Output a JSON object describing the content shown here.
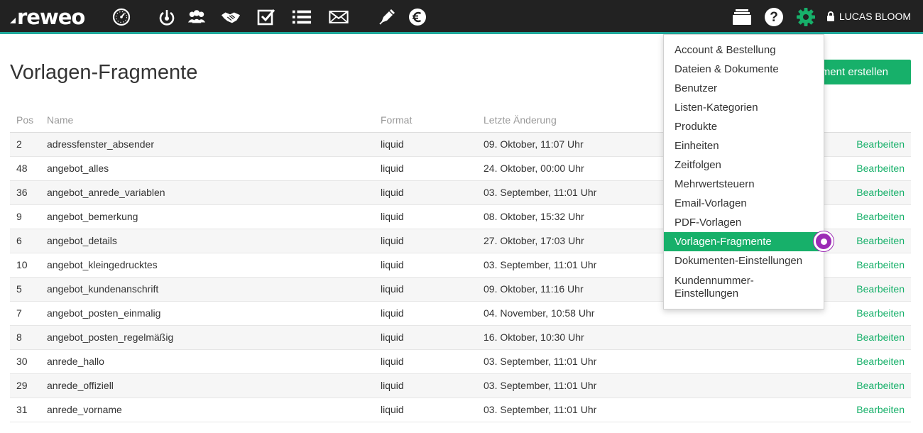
{
  "app": {
    "logo_text": "reweo"
  },
  "navbar": {
    "icons": [
      "dashboard-icon",
      "power-icon",
      "contacts-icon",
      "handshake-icon",
      "tasks-icon",
      "list-icon",
      "mail-icon",
      "pen-icon",
      "euro-icon",
      "archive-icon",
      "help-icon",
      "settings-icon"
    ],
    "user_name": "LUCAS BLOOM",
    "accent_color": "#1fa89b",
    "settings_color": "#17b06a"
  },
  "page": {
    "title": "Vorlagen-Fragmente",
    "create_button_label": "Fragment erstellen"
  },
  "table": {
    "headers": {
      "pos": "Pos",
      "name": "Name",
      "format": "Format",
      "date": "Letzte Änderung"
    },
    "edit_label": "Bearbeiten",
    "rows": [
      {
        "pos": "2",
        "name": "adressfenster_absender",
        "format": "liquid",
        "date": "09. Oktober, 11:07 Uhr"
      },
      {
        "pos": "48",
        "name": "angebot_alles",
        "format": "liquid",
        "date": "24. Oktober, 00:00 Uhr"
      },
      {
        "pos": "36",
        "name": "angebot_anrede_variablen",
        "format": "liquid",
        "date": "03. September, 11:01 Uhr"
      },
      {
        "pos": "9",
        "name": "angebot_bemerkung",
        "format": "liquid",
        "date": "08. Oktober, 15:32 Uhr"
      },
      {
        "pos": "6",
        "name": "angebot_details",
        "format": "liquid",
        "date": "27. Oktober, 17:03 Uhr"
      },
      {
        "pos": "10",
        "name": "angebot_kleingedrucktes",
        "format": "liquid",
        "date": "03. September, 11:01 Uhr"
      },
      {
        "pos": "5",
        "name": "angebot_kundenanschrift",
        "format": "liquid",
        "date": "09. Oktober, 11:16 Uhr"
      },
      {
        "pos": "7",
        "name": "angebot_posten_einmalig",
        "format": "liquid",
        "date": "04. November, 10:58 Uhr"
      },
      {
        "pos": "8",
        "name": "angebot_posten_regelmäßig",
        "format": "liquid",
        "date": "16. Oktober, 10:30 Uhr"
      },
      {
        "pos": "30",
        "name": "anrede_hallo",
        "format": "liquid",
        "date": "03. September, 11:01 Uhr"
      },
      {
        "pos": "29",
        "name": "anrede_offiziell",
        "format": "liquid",
        "date": "03. September, 11:01 Uhr"
      },
      {
        "pos": "31",
        "name": "anrede_vorname",
        "format": "liquid",
        "date": "03. September, 11:01 Uhr"
      }
    ]
  },
  "settings_menu": {
    "items": [
      "Account & Bestellung",
      "Dateien & Dokumente",
      "Benutzer",
      "Listen-Kategorien",
      "Produkte",
      "Einheiten",
      "Zeitfolgen",
      "Mehrwertsteuern",
      "Email-Vorlagen",
      "PDF-Vorlagen",
      "Vorlagen-Fragmente",
      "Dokumenten-Einstellungen",
      "Kundennummer-Einstellungen"
    ],
    "active_item": "Vorlagen-Fragmente"
  }
}
